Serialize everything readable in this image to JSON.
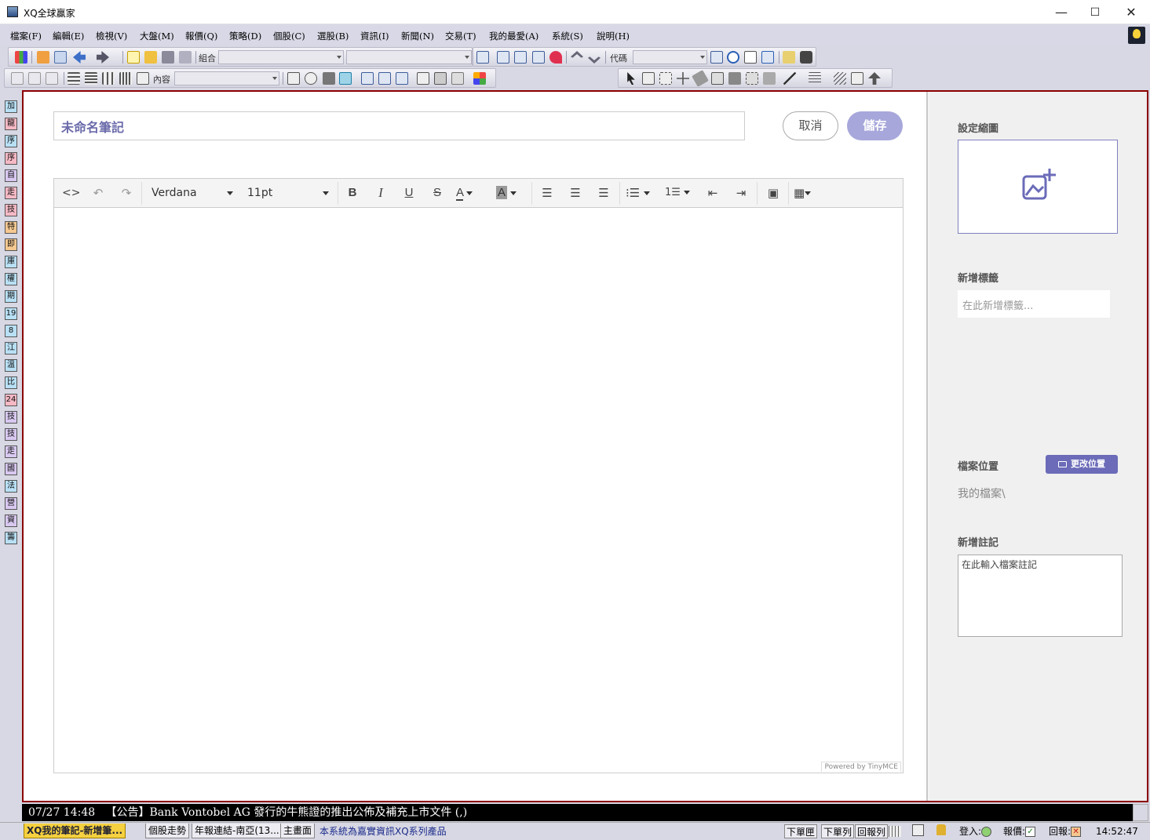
{
  "window": {
    "title": "XQ全球贏家",
    "minimize": "—",
    "maximize": "☐",
    "close": "✕"
  },
  "menu": [
    "檔案(F)",
    "編輯(E)",
    "檢視(V)",
    "大盤(M)",
    "報價(Q)",
    "策略(D)",
    "個股(C)",
    "選股(B)",
    "資訊(I)",
    "新聞(N)",
    "交易(T)",
    "我的最愛(A)",
    "系統(S)",
    "說明(H)"
  ],
  "toolbar": {
    "combo_label": "組合",
    "code_label": "代碼",
    "content_label": "內容"
  },
  "left_toolbar": [
    "加",
    "龍",
    "序",
    "序",
    "自",
    "走",
    "技",
    "特",
    "即",
    "庫",
    "權",
    "期",
    "19",
    "8",
    "江",
    "溫",
    "比",
    "24",
    "技",
    "技",
    "走",
    "國",
    "法",
    "營",
    "資",
    "籌"
  ],
  "editor": {
    "title_value": "未命名筆記",
    "cancel_label": "取消",
    "save_label": "儲存",
    "font_family": "Verdana",
    "font_size": "11pt",
    "powered_by": "Powered by TinyMCE"
  },
  "sidebar": {
    "thumbnail_label": "設定縮圖",
    "tag_label": "新增標籤",
    "tag_placeholder": "在此新增標籤...",
    "location_label": "檔案位置",
    "change_location_label": "更改位置",
    "location_path": "我的檔案\\",
    "note_label": "新增註記",
    "note_placeholder": "在此輸入檔案註記"
  },
  "ticker": {
    "time": "07/27 14:48",
    "text": "【公告】Bank Vontobel AG 發行的牛熊證的推出公佈及補充上市文件 (,)"
  },
  "statusbar": {
    "tabs": [
      "XQ我的筆記-新增筆...",
      "個股走勢",
      "年報連結-南亞(13...",
      "主畫面"
    ],
    "message": "本系統為嘉實資訊XQ系列產品",
    "buttons": [
      "下單匣",
      "下單列",
      "回報列"
    ],
    "login_label": "登入:",
    "quote_label": "報價:",
    "report_label": "回報:",
    "clock": "14:52:47"
  },
  "colors": {
    "accent": "#6b6bb9",
    "save_button": "#a7a7db",
    "frame_border": "#8b0000"
  }
}
